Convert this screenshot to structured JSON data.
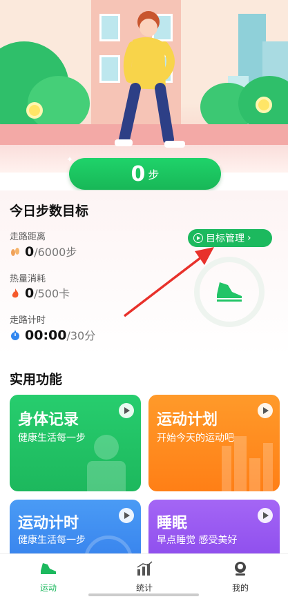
{
  "hero": {
    "steps_value": "0",
    "steps_unit": "步"
  },
  "goal": {
    "title": "今日步数目标",
    "manage_button": "目标管理",
    "distance": {
      "label": "走路距离",
      "value": "0",
      "goal": "/6000步",
      "icon": "footprint-icon"
    },
    "calories": {
      "label": "热量消耗",
      "value": "0",
      "goal": "/500卡",
      "icon": "flame-icon"
    },
    "timer": {
      "label": "走路计时",
      "value": "00:00",
      "goal": "/30分",
      "icon": "stopwatch-icon"
    }
  },
  "tools": {
    "title": "实用功能",
    "cards": [
      {
        "title": "身体记录",
        "subtitle": "健康生活每一步",
        "color": "#22c467"
      },
      {
        "title": "运动计划",
        "subtitle": "开始今天的运动吧",
        "color": "#ff8a1e"
      },
      {
        "title": "运动计时",
        "subtitle": "健康生活每一步",
        "color": "#3e8ff0"
      },
      {
        "title": "睡眠",
        "subtitle": "早点睡觉 感受美好",
        "color": "#9a5cf0"
      }
    ]
  },
  "tabbar": {
    "items": [
      {
        "label": "运动",
        "icon": "sneaker-icon",
        "active": true
      },
      {
        "label": "统计",
        "icon": "bar-chart-icon",
        "active": false
      },
      {
        "label": "我的",
        "icon": "profile-icon",
        "active": false
      }
    ]
  },
  "colors": {
    "accent": "#1cb95e",
    "road": "#f3a9a6"
  }
}
